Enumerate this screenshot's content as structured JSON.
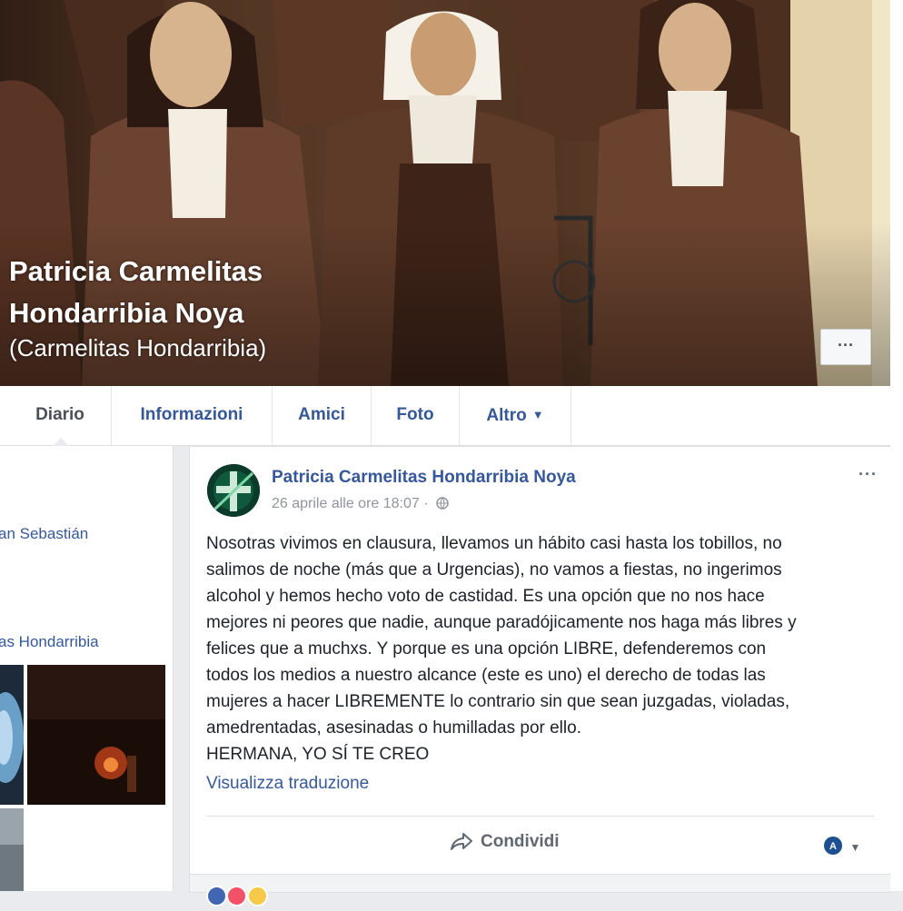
{
  "cover": {
    "name_line1": "Patricia Carmelitas",
    "name_line2": "Hondarribia Noya",
    "alternate_name": "(Carmelitas Hondarribia)",
    "more_label": "···"
  },
  "tabs": [
    {
      "label": "Diario",
      "active": true
    },
    {
      "label": "Informazioni"
    },
    {
      "label": "Amici"
    },
    {
      "label": "Foto"
    },
    {
      "label": "Altro",
      "caret": "▼"
    }
  ],
  "left": {
    "link1": "an Sebastián",
    "link2": "as Hondarribia"
  },
  "post": {
    "author": "Patricia Carmelitas Hondarribia Noya",
    "timestamp": "26 aprile alle ore 18:07 ·",
    "privacy_icon": "globe-icon",
    "more_label": "···",
    "text_lines": [
      "Nosotras vivimos en clausura, llevamos un hábito casi hasta los tobillos, no",
      "salimos de noche (más que a Urgencias), no vamos a fiestas, no ingerimos",
      "alcohol y hemos hecho voto de castidad. Es una opción que no nos hace",
      "mejores ni peores que nadie, aunque paradójicamente nos haga más libres y",
      "felices que a muchxs. Y porque es una opción LIBRE, defenderemos con",
      "todos los medios a nuestro alcance (este es uno) el derecho de todas las",
      "mujeres a hacer LIBREMENTE lo contrario sin que sean juzgadas, violadas,",
      "amedrentadas, asesinadas o humilladas por ello.",
      "HERMANA, YO SÍ TE CREO"
    ],
    "translate_label": "Visualizza traduzione",
    "share_label": "Condividi",
    "share_icon": "share-arrow-icon",
    "audience_icon": "page-avatar-icon",
    "audience_caret": "▼"
  },
  "colors": {
    "link": "#365899",
    "page_bg": "#e9ebee",
    "text": "#1d2129",
    "muted": "#90949c"
  }
}
